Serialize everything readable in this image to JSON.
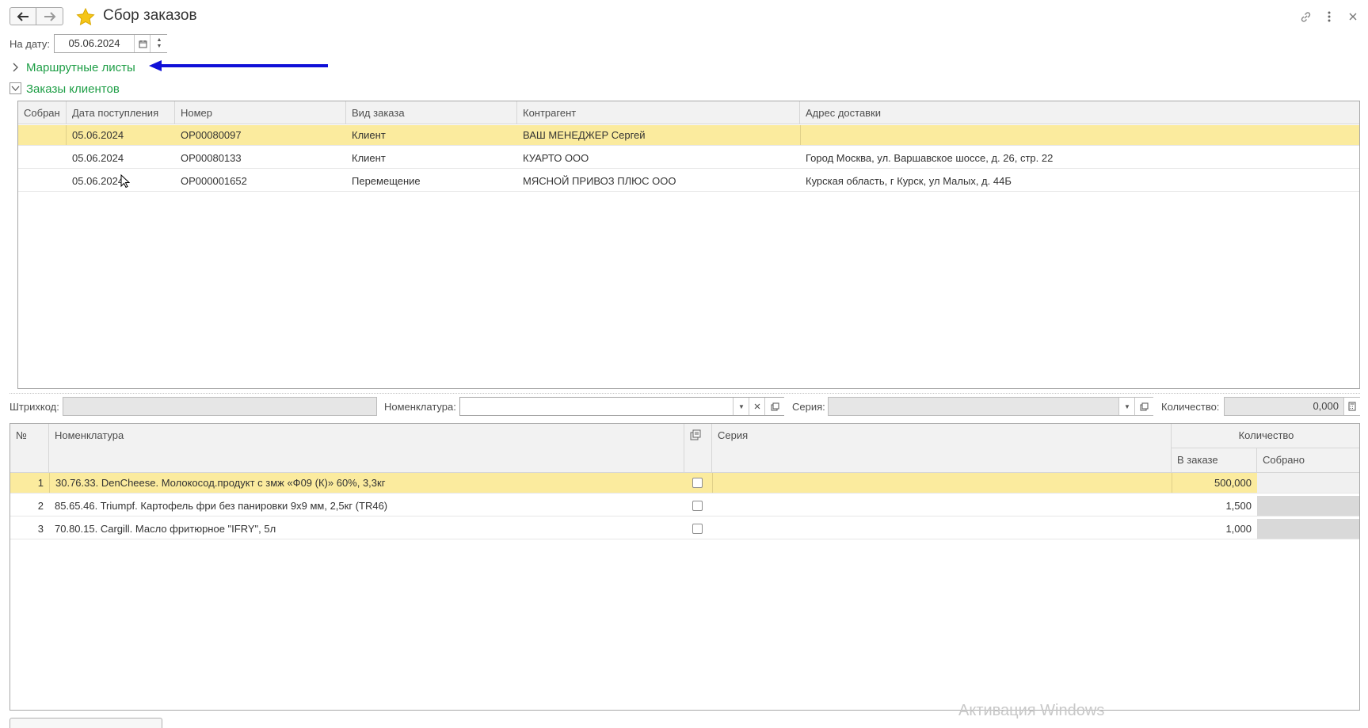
{
  "header": {
    "title": "Сбор заказов",
    "back_icon": "arrow-left-icon",
    "forward_icon": "arrow-right-icon",
    "favorite_icon": "star-icon",
    "link_icon": "link-icon",
    "more_icon": "more-vertical-icon",
    "close_icon": "close-icon"
  },
  "date_filter": {
    "label": "На дату:",
    "value": "05.06.2024"
  },
  "groups": {
    "route_sheets": "Маршрутные листы",
    "customer_orders": "Заказы клиентов"
  },
  "orders_table": {
    "columns": [
      "Собран",
      "Дата поступления",
      "Номер",
      "Вид заказа",
      "Контрагент",
      "Адрес доставки"
    ],
    "rows": [
      {
        "collected": "",
        "date": "05.06.2024",
        "number": "ОР00080097",
        "kind": "Клиент",
        "counterparty": "ВАШ МЕНЕДЖЕР Сергей",
        "address": ""
      },
      {
        "collected": "",
        "date": "05.06.2024",
        "number": "ОР00080133",
        "kind": "Клиент",
        "counterparty": "КУАРТО ООО",
        "address": "Город Москва, ул. Варшавское шоссе, д. 26, стр. 22"
      },
      {
        "collected": "",
        "date": "05.06.2024",
        "number": "ОР000001652",
        "kind": "Перемещение",
        "counterparty": "МЯСНОЙ ПРИВОЗ ПЛЮС ООО",
        "address": "Курская область, г Курск, ул Малых, д. 44Б"
      }
    ]
  },
  "scan_bar": {
    "barcode_label": "Штрихкод:",
    "barcode_value": "",
    "nomenclature_label": "Номенклатура:",
    "nomenclature_value": "",
    "series_label": "Серия:",
    "series_value": "",
    "quantity_label": "Количество:",
    "quantity_value": "0,000"
  },
  "items_table": {
    "columns": {
      "num": "№",
      "nomenclature": "Номенклатура",
      "series": "Серия",
      "quantity": "Количество",
      "in_order": "В заказе",
      "collected": "Собрано"
    },
    "rows": [
      {
        "num": "1",
        "nomenclature": "30.76.33. DenCheese. Молокосод.продукт с змж «Ф09 (К)» 60%, 3,3кг",
        "checked": false,
        "series": "",
        "in_order": "500,000",
        "collected": ""
      },
      {
        "num": "2",
        "nomenclature": "85.65.46. Triumpf. Картофель фри без панировки 9х9 мм, 2,5кг (TR46)",
        "checked": false,
        "series": "",
        "in_order": "1,500",
        "collected": ""
      },
      {
        "num": "3",
        "nomenclature": "70.80.15. Cargill. Масло фритюрное \"IFRY\", 5л",
        "checked": false,
        "series": "",
        "in_order": "1,000",
        "collected": ""
      }
    ]
  },
  "watermark": "Активация Windows",
  "colors": {
    "group_green": "#1e9e46",
    "selected_row": "#fbeb9e",
    "arrow_blue": "#1010d8"
  }
}
